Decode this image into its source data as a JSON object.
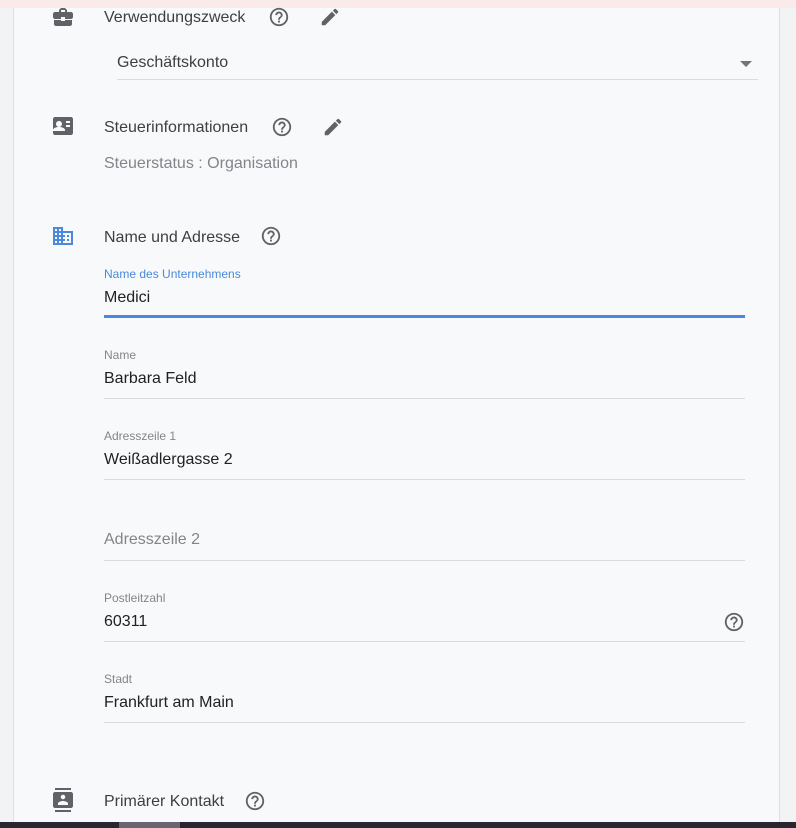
{
  "sections": {
    "purpose": {
      "title": "Verwendungszweck",
      "icons": {
        "section": "briefcase-icon",
        "help": "help-icon",
        "edit": "edit-pencil-icon"
      },
      "select_value": "Geschäftskonto"
    },
    "tax": {
      "title": "Steuerinformationen",
      "icons": {
        "section": "contact-card-icon",
        "help": "help-icon",
        "edit": "edit-pencil-icon"
      },
      "status_line": "Steuerstatus : Organisation"
    },
    "address": {
      "title": "Name und Adresse",
      "icons": {
        "section": "business-building-icon",
        "help": "help-icon"
      },
      "fields": [
        {
          "label": "Name des Unternehmens",
          "value": "Medici",
          "focused": true
        },
        {
          "label": "Name",
          "value": "Barbara Feld"
        },
        {
          "label": "Adresszeile 1",
          "value": "Weißadlergasse 2"
        },
        {
          "label": "",
          "placeholder": "Adresszeile 2",
          "value": ""
        },
        {
          "label": "Postleitzahl",
          "value": "60311",
          "help_icon": "help-icon"
        },
        {
          "label": "Stadt",
          "value": "Frankfurt am Main"
        }
      ]
    },
    "contact": {
      "title": "Primärer Kontakt",
      "icons": {
        "section": "contact-person-icon",
        "help": "help-icon"
      }
    }
  },
  "colors": {
    "accent": "#4a89dc",
    "icon_grey": "#5f6368",
    "divider": "#dadce0"
  }
}
